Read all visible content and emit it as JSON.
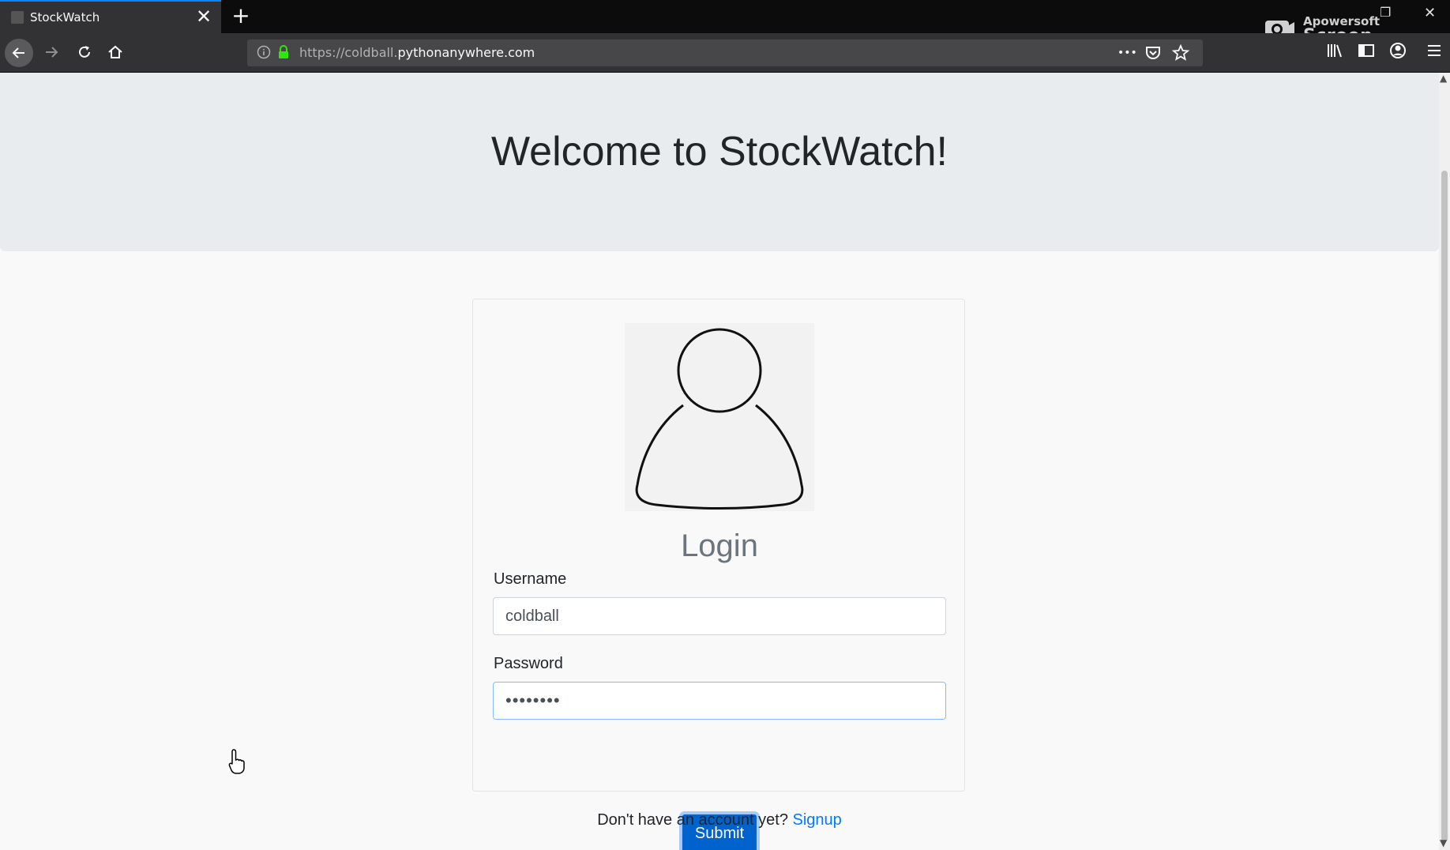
{
  "browser": {
    "tab_title": "StockWatch",
    "new_tab_symbol": "+",
    "close_symbol": "✕",
    "url_prefix": "https://coldball.",
    "url_host": "pythonanywhere.com",
    "menu_dots": "•••"
  },
  "recorder": {
    "line1": "Apowersoft",
    "line2": "Screen Recorder"
  },
  "page": {
    "heading": "Welcome to StockWatch!",
    "login_title": "Login",
    "username_label": "Username",
    "username_value": "coldball",
    "password_label": "Password",
    "password_value": "••••••••",
    "submit_label": "Submit",
    "signup_prompt": "Don't have an account yet?",
    "signup_link": "Signup"
  },
  "colors": {
    "accent": "#007bff",
    "button": "#0062cc",
    "jumbotron": "#e9ecef",
    "chrome": "#323234"
  }
}
